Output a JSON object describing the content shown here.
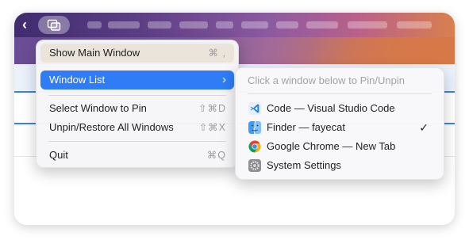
{
  "menubar": {
    "back_glyph": "‹",
    "app_icon_name": "window-stack-icon"
  },
  "menu": {
    "items": [
      {
        "label": "Show Main Window",
        "shortcut": "⌘ ,"
      },
      {
        "label": "Window List",
        "shortcut": "›"
      },
      {
        "label": "Select Window to Pin",
        "shortcut": "⇧⌘D"
      },
      {
        "label": "Unpin/Restore All Windows",
        "shortcut": "⇧⌘X"
      },
      {
        "label": "Quit",
        "shortcut": "⌘Q"
      }
    ]
  },
  "submenu": {
    "hint": "Click a window below to Pin/Unpin",
    "windows": [
      {
        "label": "Code — Visual Studio Code",
        "icon": "vscode-icon",
        "checked": false
      },
      {
        "label": "Finder — fayecat",
        "icon": "finder-icon",
        "checked": true
      },
      {
        "label": "Google Chrome — New Tab",
        "icon": "chrome-icon",
        "checked": false
      },
      {
        "label": "System Settings",
        "icon": "settings-gear-icon",
        "checked": false
      }
    ],
    "check_glyph": "✓"
  },
  "colors": {
    "highlight": "#2f7cf6",
    "accent_line": "#3c82e6"
  }
}
